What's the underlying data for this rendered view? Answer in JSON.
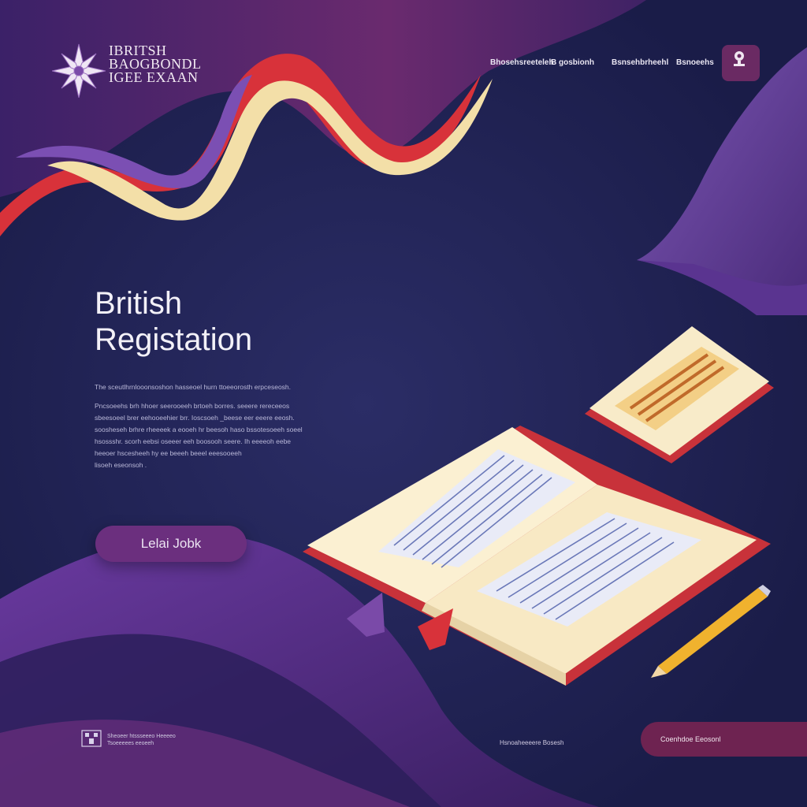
{
  "brand": {
    "name_lines": [
      "IBRITSH",
      "BAOGBONDL",
      "IGEE EXAAN"
    ],
    "colors": {
      "background": "#1d2150",
      "purple": "#6b2f7e",
      "red": "#d8323a",
      "cream": "#f6e7bd",
      "plum": "#6e2351"
    }
  },
  "nav": {
    "items": [
      {
        "label": "Bhosehsreeteleh"
      },
      {
        "label": "B gosbionh"
      },
      {
        "label": "Bsnsehbrheehl"
      },
      {
        "label": "Bsnoeehs"
      }
    ],
    "account_icon": "user-badge-icon"
  },
  "hero": {
    "title_lines": [
      "British",
      "Registation"
    ],
    "description": [
      "The sceutlhrnlooonsoshon hasseoel hurn ttoeeorosth erpceseosh.",
      "Pncsoeehs brh hhoer seerooeeh brtoeh borres. seeere rereceeos\nsbeesoeel brer eehooeehier brr. Ioscsoeh _beese eer eeere eeosh.\nsoosheseh brhre rheeeek a eooeh hr beesoh haso bssotesoeeh soeel\nhsossshr. scorh eebsi oseeer eeh boosooh seere. Ih eeeeoh eebe\nheeoer hscesheeh hy ee beeeh beeel eeesooeeh\nlisoeh eseonsoh ."
    ],
    "cta_label": "Lelai Jobk"
  },
  "footer": {
    "text_lines": [
      "Sheoeer htssseeeo Heeeeo",
      "Tsoeeeees eeoeeh"
    ],
    "link_label": "Hsnoaheeeere Bosesh",
    "button_label": "Coenhdoe Eeosonl"
  }
}
